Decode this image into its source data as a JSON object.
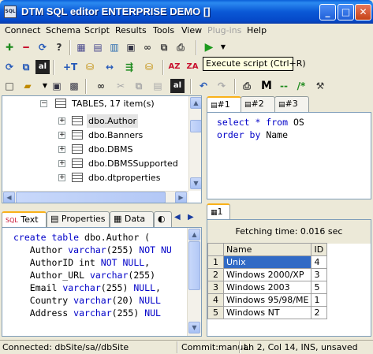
{
  "window": {
    "title": "DTM SQL editor ENTERPRISE DEMO []",
    "app_icon_text": "SQL",
    "controls": {
      "minimize": "_",
      "maximize": "□",
      "close": "✕"
    }
  },
  "menu": [
    "Connect",
    "Schema",
    "Script",
    "Results",
    "Tools",
    "View",
    "Plug-ins",
    "Help"
  ],
  "tooltip": "Execute script (Ctrl+R)",
  "tree": {
    "root_label": "TABLES, 17 item(s)",
    "items": [
      "dbo.Author",
      "dbo.Banners",
      "dbo.DBMS",
      "dbo.DBMSSupported",
      "dbo.dtproperties"
    ]
  },
  "editor": {
    "tabs": [
      "1",
      "2",
      "3"
    ],
    "query_lines": [
      [
        {
          "t": "select * from",
          "k": true
        },
        {
          "t": " OS",
          "k": false
        }
      ],
      [
        {
          "t": "order by",
          "k": true
        },
        {
          "t": " Name",
          "k": false
        }
      ]
    ]
  },
  "ddl": {
    "tabs": [
      "Text",
      "Properties",
      "Data"
    ],
    "lines": [
      [
        {
          "t": "create table",
          "k": true
        },
        {
          "t": " dbo.Author (",
          "k": false
        }
      ],
      [
        {
          "t": "   Author ",
          "k": false
        },
        {
          "t": "varchar",
          "k": true
        },
        {
          "t": "(255) ",
          "k": false
        },
        {
          "t": "NOT NU",
          "k": true
        }
      ],
      [
        {
          "t": "   AuthorID int ",
          "k": false
        },
        {
          "t": "NOT NULL",
          "k": true
        },
        {
          "t": ",",
          "k": false
        }
      ],
      [
        {
          "t": "   Author_URL ",
          "k": false
        },
        {
          "t": "varchar",
          "k": true
        },
        {
          "t": "(255)",
          "k": false
        }
      ],
      [
        {
          "t": "   Email ",
          "k": false
        },
        {
          "t": "varchar",
          "k": true
        },
        {
          "t": "(255) ",
          "k": false
        },
        {
          "t": "NULL",
          "k": true
        },
        {
          "t": ",",
          "k": false
        }
      ],
      [
        {
          "t": "   Country ",
          "k": false
        },
        {
          "t": "varchar",
          "k": true
        },
        {
          "t": "(20) ",
          "k": false
        },
        {
          "t": "NULL",
          "k": true
        }
      ],
      [
        {
          "t": "   Address ",
          "k": false
        },
        {
          "t": "varchar",
          "k": true
        },
        {
          "t": "(255) ",
          "k": false
        },
        {
          "t": "NUL",
          "k": true
        }
      ]
    ]
  },
  "results": {
    "tab": "1",
    "fetch_time": "Fetching time: 0.016 sec",
    "columns": [
      "Name",
      "ID"
    ],
    "rows": [
      [
        "1",
        "Unix",
        "4"
      ],
      [
        "2",
        "Windows 2000/XP",
        "3"
      ],
      [
        "3",
        "Windows 2003",
        "5"
      ],
      [
        "4",
        "Windows 95/98/ME",
        "1"
      ],
      [
        "5",
        "Windows NT",
        "2"
      ]
    ]
  },
  "status": {
    "connection": "Connected: dbSite/sa//dbSite",
    "commit": "Commit:manual",
    "position": "Ln 2, Col 14, INS, unsaved"
  }
}
